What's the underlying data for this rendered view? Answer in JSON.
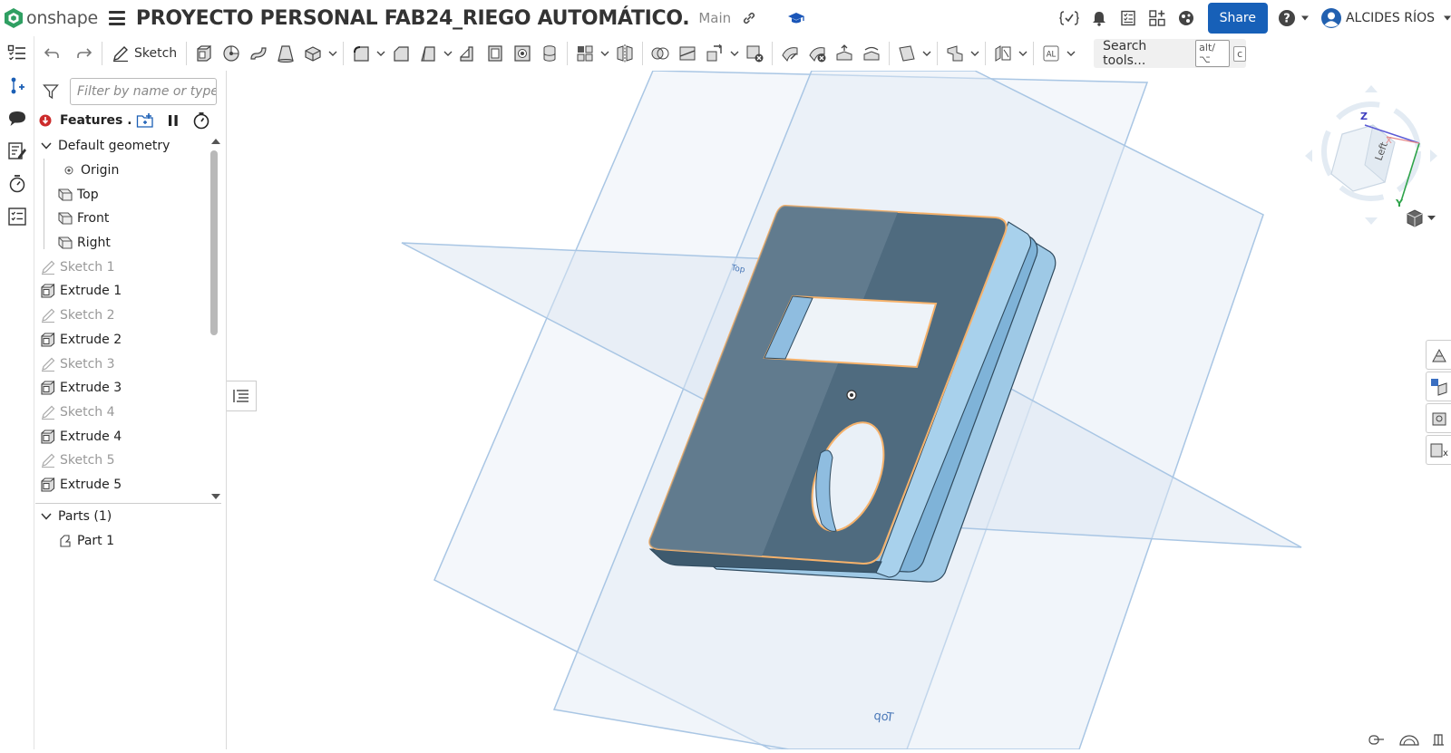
{
  "app": {
    "logo_text": "onshape"
  },
  "document": {
    "title": "PROYECTO PERSONAL FAB24_RIEGO AUTOMÁTICO.",
    "branch": "Main"
  },
  "header": {
    "share_label": "Share",
    "user_name": "ALCIDES RÍOS"
  },
  "toolbar": {
    "sketch_label": "Sketch",
    "search_placeholder": "Search tools...",
    "search_shortcut_1": "alt/⌥",
    "search_shortcut_2": "c",
    "units_label": "AL"
  },
  "feature_panel": {
    "filter_placeholder": "Filter by name or type",
    "title": "Features ...",
    "default_geometry_label": "Default geometry",
    "default_geometry": [
      {
        "label": "Origin",
        "icon": "origin-icon"
      },
      {
        "label": "Top",
        "icon": "plane-icon"
      },
      {
        "label": "Front",
        "icon": "plane-icon"
      },
      {
        "label": "Right",
        "icon": "plane-icon"
      }
    ],
    "features": [
      {
        "label": "Sketch 1",
        "type": "sketch",
        "dim": true
      },
      {
        "label": "Extrude 1",
        "type": "extrude",
        "dim": false
      },
      {
        "label": "Sketch 2",
        "type": "sketch",
        "dim": true
      },
      {
        "label": "Extrude 2",
        "type": "extrude",
        "dim": false
      },
      {
        "label": "Sketch 3",
        "type": "sketch",
        "dim": true
      },
      {
        "label": "Extrude 3",
        "type": "extrude",
        "dim": false
      },
      {
        "label": "Sketch 4",
        "type": "sketch",
        "dim": true
      },
      {
        "label": "Extrude 4",
        "type": "extrude",
        "dim": false
      },
      {
        "label": "Sketch 5",
        "type": "sketch",
        "dim": true
      },
      {
        "label": "Extrude 5",
        "type": "extrude",
        "dim": false
      }
    ],
    "parts_label": "Parts (1)",
    "parts": [
      {
        "label": "Part 1"
      }
    ]
  },
  "viewport": {
    "plane_label": "Top",
    "view_cube": {
      "face_label": "Left",
      "axis_z": "Z",
      "axis_y": "Y",
      "axis_x": "X"
    }
  },
  "colors": {
    "accent": "#1760b8",
    "plane_fill": "#dde8f3",
    "plane_stroke": "#9ec0e2",
    "part_face": "#4f6b7f",
    "part_side": "#8ebfe0",
    "selection": "#f6b26b"
  }
}
